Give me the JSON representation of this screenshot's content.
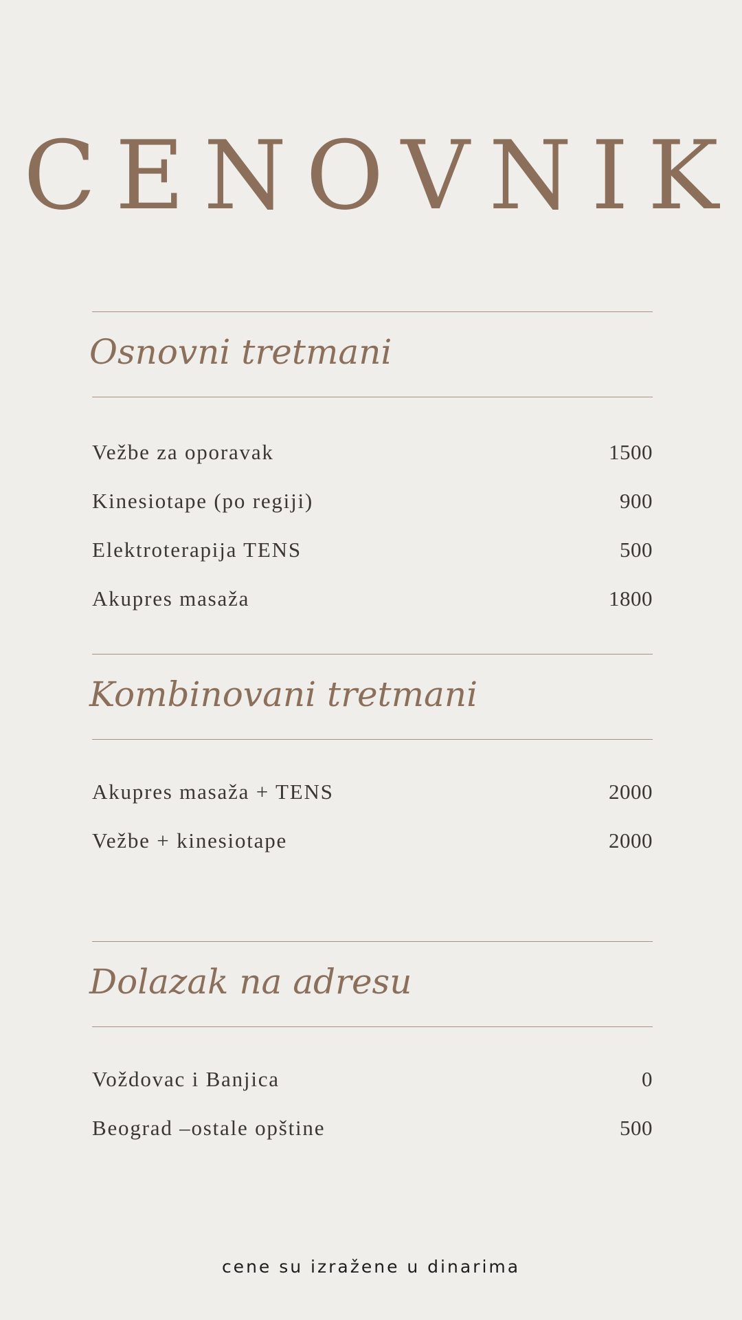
{
  "title": "CENOVNIK",
  "sections": [
    {
      "heading": "Osnovni tretmani",
      "items": [
        {
          "name": "Vežbe za oporavak",
          "price": "1500"
        },
        {
          "name": "Kinesiotape (po regiji)",
          "price": "900"
        },
        {
          "name": "Elektroterapija TENS",
          "price": "500"
        },
        {
          "name": "Akupres masaža",
          "price": "1800"
        }
      ]
    },
    {
      "heading": "Kombinovani tretmani",
      "items": [
        {
          "name": "Akupres masaža + TENS",
          "price": "2000"
        },
        {
          "name": "Vežbe + kinesiotape",
          "price": "2000"
        }
      ]
    },
    {
      "heading": "Dolazak na adresu",
      "items": [
        {
          "name": "Voždovac i Banjica",
          "price": "0"
        },
        {
          "name": "Beograd –ostale opštine",
          "price": "500"
        }
      ]
    }
  ],
  "footnote": "cene su izražene u dinarima"
}
